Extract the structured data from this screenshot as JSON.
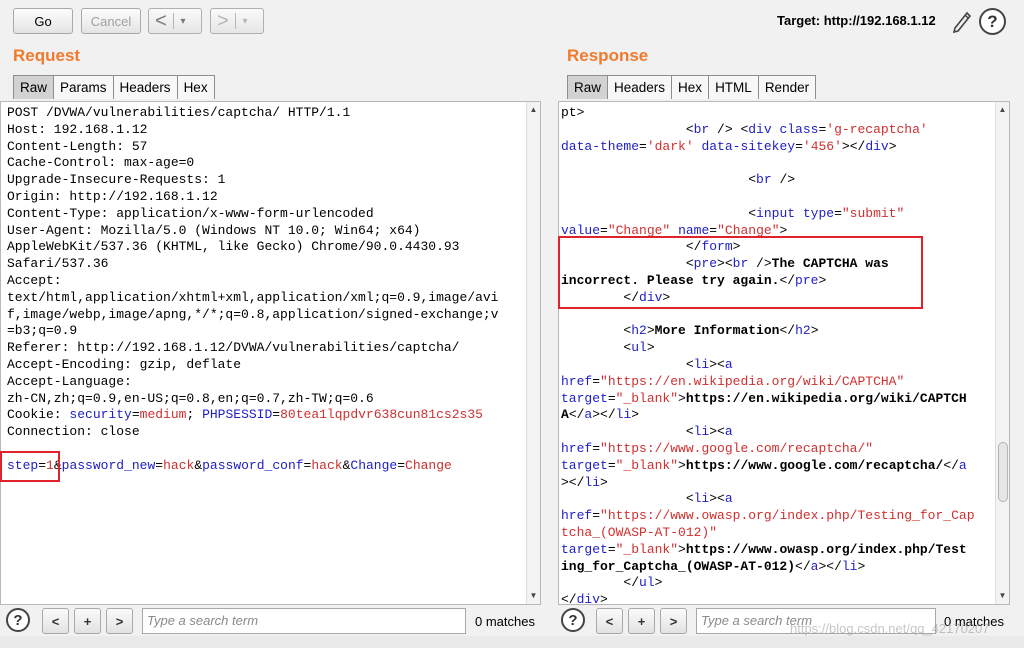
{
  "toolbar": {
    "go_label": "Go",
    "cancel_label": "Cancel",
    "back_glyph": "<",
    "forward_glyph": ">",
    "dropdown_glyph": "▾",
    "target_text": "Target: http://192.168.1.12",
    "help_glyph": "?"
  },
  "request": {
    "title": "Request",
    "tabs": [
      "Raw",
      "Params",
      "Headers",
      "Hex"
    ],
    "active_tab": "Raw",
    "lines": [
      "POST /DVWA/vulnerabilities/captcha/ HTTP/1.1",
      "Host: 192.168.1.12",
      "Content-Length: 57",
      "Cache-Control: max-age=0",
      "Upgrade-Insecure-Requests: 1",
      "Origin: http://192.168.1.12",
      "Content-Type: application/x-www-form-urlencoded",
      "User-Agent: Mozilla/5.0 (Windows NT 10.0; Win64; x64)",
      "AppleWebKit/537.36 (KHTML, like Gecko) Chrome/90.0.4430.93",
      "Safari/537.36",
      "Accept:",
      "text/html,application/xhtml+xml,application/xml;q=0.9,image/avi",
      "f,image/webp,image/apng,*/*;q=0.8,application/signed-exchange;v",
      "=b3;q=0.9",
      "Referer: http://192.168.1.12/DVWA/vulnerabilities/captcha/",
      "Accept-Encoding: gzip, deflate",
      "Accept-Language:",
      "zh-CN,zh;q=0.9,en-US;q=0.8,en;q=0.7,zh-TW;q=0.6"
    ],
    "cookie": {
      "prefix": "Cookie: ",
      "k1": "security",
      "v1": "medium",
      "sep": "; ",
      "k2": "PHPSESSID",
      "v2": "80tea1lqpdvr638cun81cs2s35"
    },
    "connection": "Connection: close",
    "body_params": [
      {
        "k": "step",
        "v": "1"
      },
      {
        "k": "password_new",
        "v": "hack"
      },
      {
        "k": "password_conf",
        "v": "hack"
      },
      {
        "k": "Change",
        "v": "Change"
      }
    ],
    "search_placeholder": "Type a search term",
    "matches": "0 matches"
  },
  "response": {
    "title": "Response",
    "tabs": [
      "Raw",
      "Headers",
      "Hex",
      "HTML",
      "Render"
    ],
    "active_tab": "Raw",
    "search_placeholder": "Type a search term",
    "matches": "0 matches"
  },
  "watermark": "https://blog.csdn.net/qq_42170207"
}
